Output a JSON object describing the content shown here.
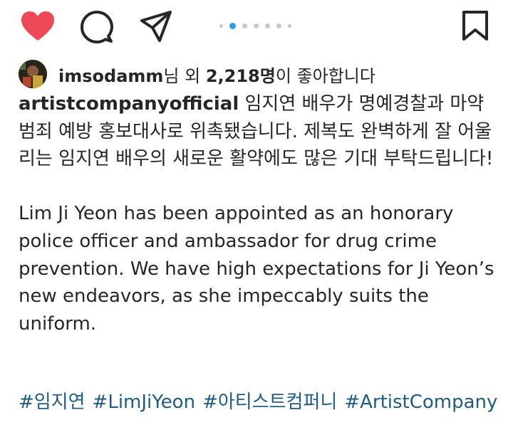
{
  "actions": {
    "like_color": "#ed4956",
    "carousel": {
      "total": 7,
      "active_index": 1
    }
  },
  "likes": {
    "username": "imsodamm",
    "middle": "님 외 ",
    "count": "2,218명",
    "suffix": "이 좋아합니다"
  },
  "caption": {
    "username": "artistcompanyofficial",
    "korean": " 임지연 배우가 명예경찰과 마약 범죄 예방 홍보대사로 위촉됐습니다. 제복도 완벽하게 잘 어울리는 임지연 배우의 새로운 활약에도 많은 기대 부탁드립니다!",
    "english": "Lim Ji Yeon has been appointed as an honorary police officer and ambassador for drug crime prevention. We have high expectations for Ji Yeon’s new endeavors, as she impeccably suits the uniform."
  },
  "hashtags": [
    "#임지연",
    "#LimJiYeon",
    "#아티스트컴퍼니",
    "#ArtistCompany"
  ],
  "colors": {
    "hashtag": "#1f5b84",
    "text": "#262626",
    "carousel_active": "#2d9cf0"
  }
}
